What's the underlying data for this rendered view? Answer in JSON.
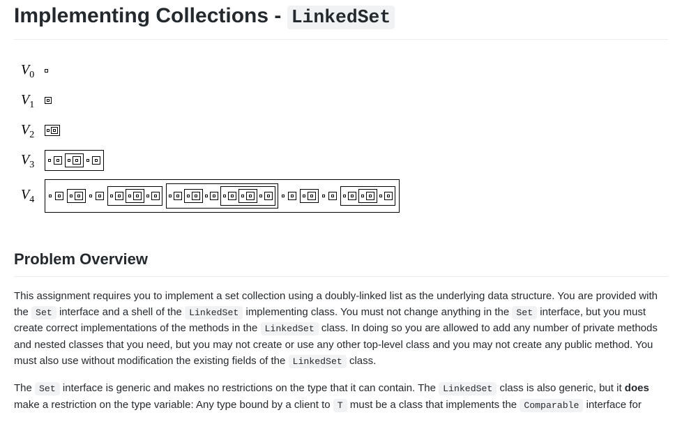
{
  "title": {
    "prefix": "Implementing Collections - ",
    "code": "LinkedSet"
  },
  "figure": {
    "rows": [
      {
        "label_var": "V",
        "label_sub": "0"
      },
      {
        "label_var": "V",
        "label_sub": "1"
      },
      {
        "label_var": "V",
        "label_sub": "2"
      },
      {
        "label_var": "V",
        "label_sub": "3"
      },
      {
        "label_var": "V",
        "label_sub": "4"
      }
    ]
  },
  "section": {
    "heading": "Problem Overview",
    "p1": {
      "t1": "This assignment requires you to implement a set collection using a doubly-linked list as the underlying data structure. You are provided with the ",
      "c1": "Set",
      "t2": " interface and a shell of the ",
      "c2": "LinkedSet",
      "t3": " implementing class. You must not change anything in the ",
      "c3": "Set",
      "t4": " interface, but you must create correct implementations of the methods in the ",
      "c4": "LinkedSet",
      "t5": " class. In doing so you are allowed to add any number of private methods and nested classes that you need, but you may not create or use any other top-level class and you may not create any public method. You must also use without modification the existing fields of the ",
      "c5": "LinkedSet",
      "t6": " class."
    },
    "p2": {
      "t1": "The ",
      "c1": "Set",
      "t2": " interface is generic and makes no restrictions on the type that it can contain. The ",
      "c2": "LinkedSet",
      "t3": " class is also generic, but it ",
      "b1": "does",
      "t4": " make a restriction on the type variable: Any type bound by a client to ",
      "c3": "T",
      "t5": " must be a class that implements the ",
      "c4": "Comparable",
      "t6": " interface for"
    }
  }
}
